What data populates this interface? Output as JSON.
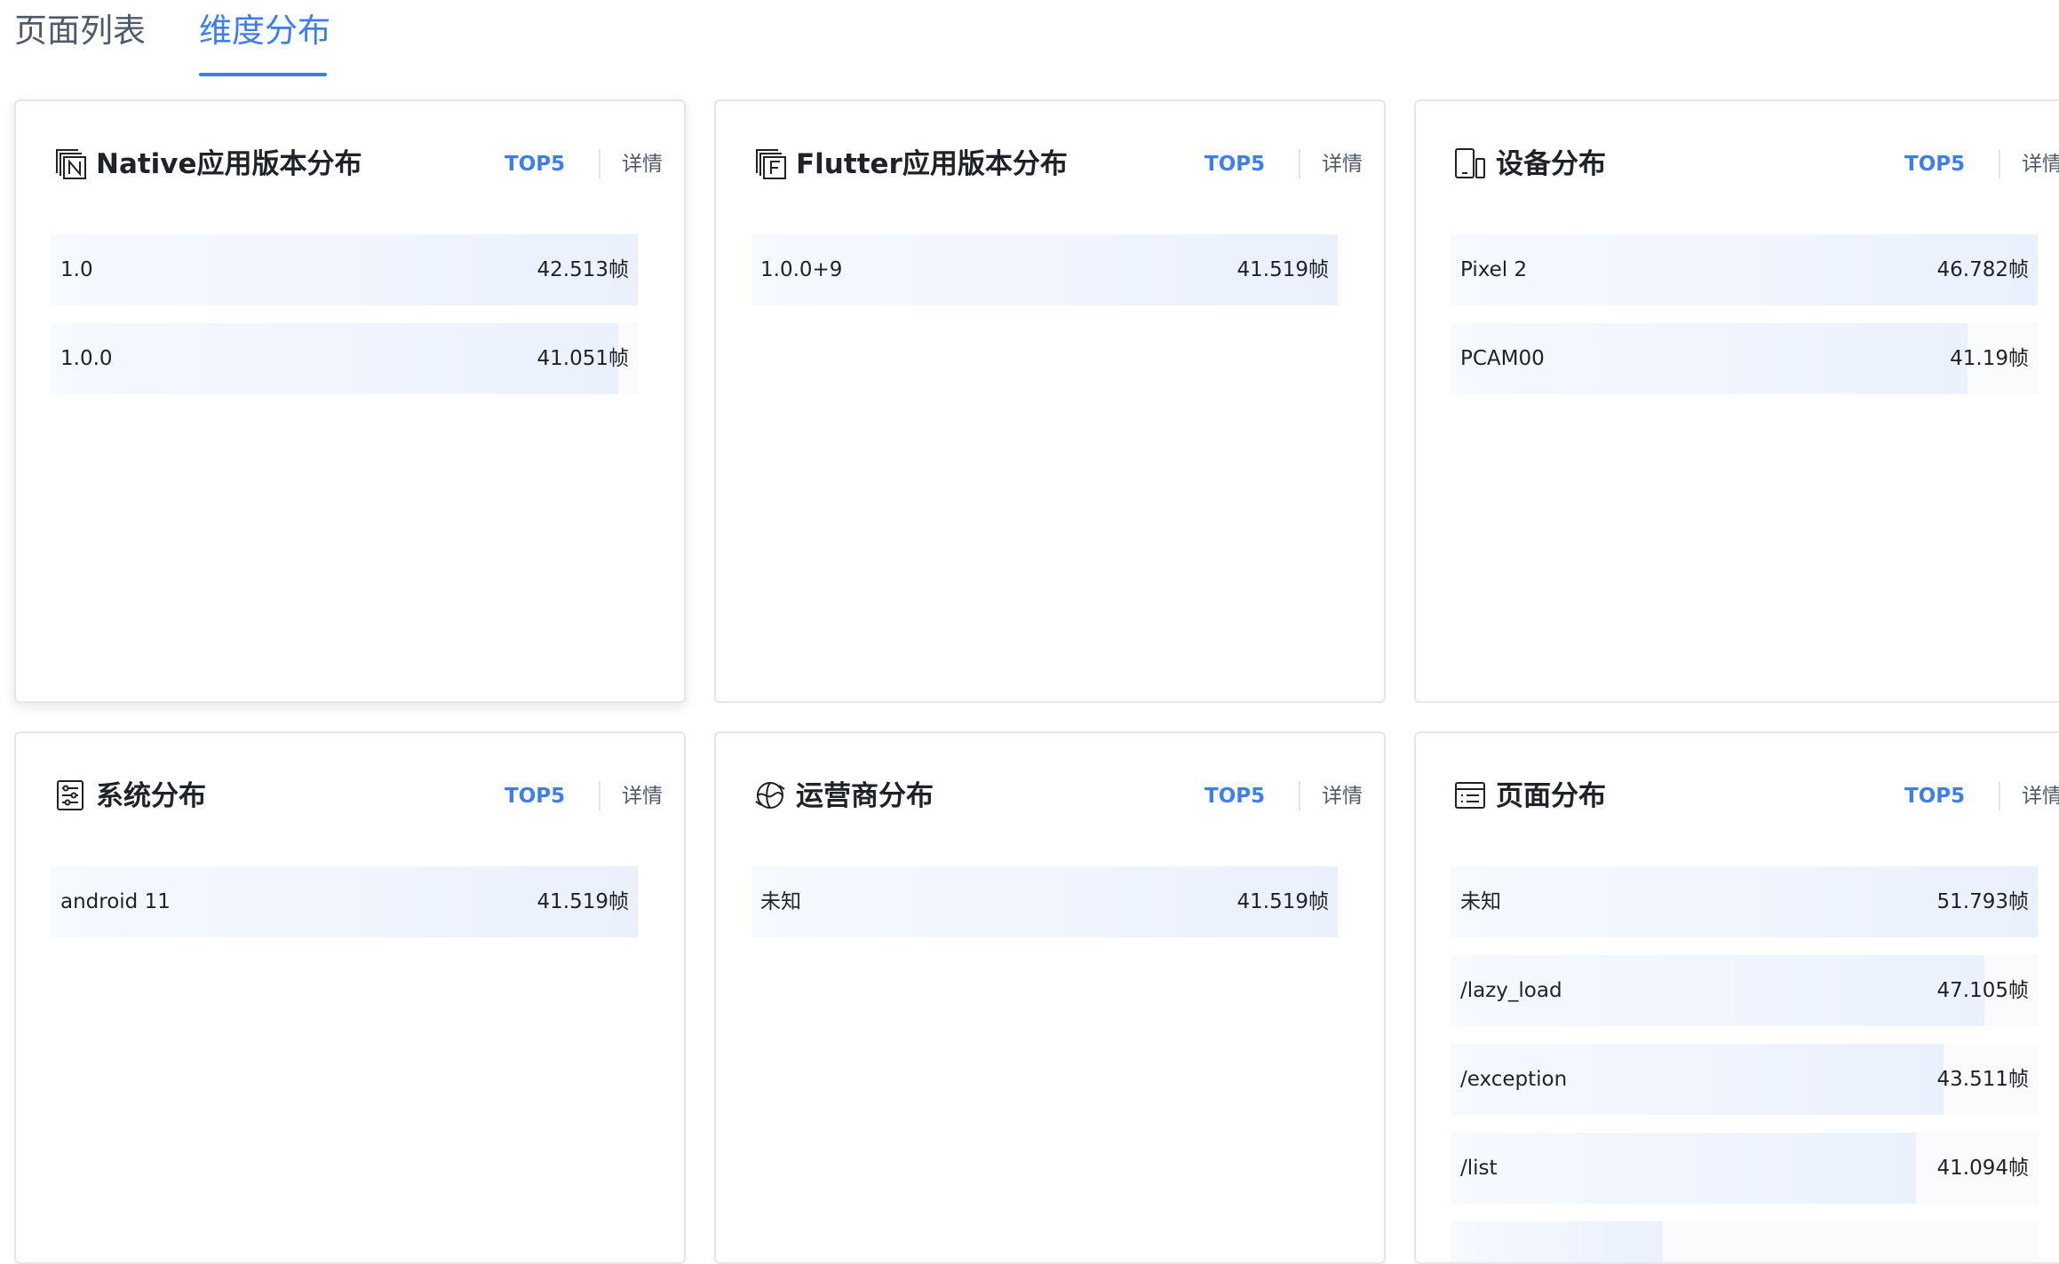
{
  "tabs": [
    {
      "label": "页面列表",
      "active": false
    },
    {
      "label": "维度分布",
      "active": true
    }
  ],
  "accent_color": "#3c7ef0",
  "cards": [
    {
      "title": "Native应用版本分布",
      "icon": "native-version-icon",
      "top5": "TOP5",
      "detail": "详情",
      "rows": [
        {
          "label": "1.0",
          "value": "42.513帧",
          "fraction": 1.0
        },
        {
          "label": "1.0.0",
          "value": "41.051帧",
          "fraction": 0.966
        }
      ]
    },
    {
      "title": "Flutter应用版本分布",
      "icon": "flutter-version-icon",
      "top5": "TOP5",
      "detail": "详情",
      "rows": [
        {
          "label": "1.0.0+9",
          "value": "41.519帧",
          "fraction": 1.0
        }
      ]
    },
    {
      "title": "设备分布",
      "icon": "device-icon",
      "top5": "TOP5",
      "detail": "详情",
      "rows": [
        {
          "label": "Pixel 2",
          "value": "46.782帧",
          "fraction": 1.0
        },
        {
          "label": "PCAM00",
          "value": "41.19帧",
          "fraction": 0.88
        }
      ]
    },
    {
      "title": "系统分布",
      "icon": "system-icon",
      "top5": "TOP5",
      "detail": "详情",
      "rows": [
        {
          "label": "android 11",
          "value": "41.519帧",
          "fraction": 1.0
        }
      ]
    },
    {
      "title": "运营商分布",
      "icon": "carrier-icon",
      "top5": "TOP5",
      "detail": "详情",
      "rows": [
        {
          "label": "未知",
          "value": "41.519帧",
          "fraction": 1.0
        }
      ]
    },
    {
      "title": "页面分布",
      "icon": "page-icon",
      "top5": "TOP5",
      "detail": "详情",
      "rows": [
        {
          "label": "未知",
          "value": "51.793帧",
          "fraction": 1.0
        },
        {
          "label": "/lazy_load",
          "value": "47.105帧",
          "fraction": 0.909
        },
        {
          "label": "/exception",
          "value": "43.511帧",
          "fraction": 0.84
        },
        {
          "label": "/list",
          "value": "41.094帧",
          "fraction": 0.793
        },
        {
          "label": "",
          "value": "",
          "fraction": 0.36
        }
      ]
    }
  ]
}
